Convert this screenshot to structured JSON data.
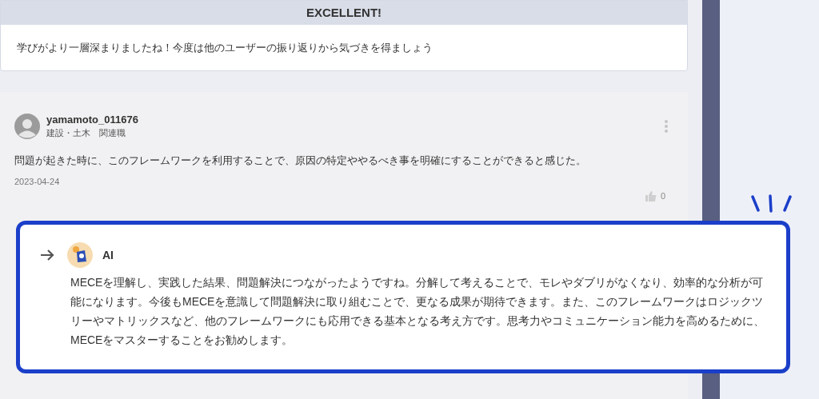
{
  "result": {
    "title": "EXCELLENT!",
    "message": "学びがより一層深まりましたね！今度は他のユーザーの振り返りから気づきを得ましょう"
  },
  "comment": {
    "username": "yamamoto_011676",
    "category": "建設・土木　関連職",
    "body": "問題が起きた時に、このフレームワークを利用することで、原因の特定ややるべき事を明確にすることができると感じた。",
    "date": "2023-04-24",
    "likes": "0",
    "liked": false
  },
  "ai_reply": {
    "name": "AI",
    "body": "MECEを理解し、実践した結果、問題解決につながったようですね。分解して考えることで、モレやダブリがなくなり、効率的な分析が可能になります。今後もMECEを意識して問題解決に取り組むことで、更なる成果が期待できます。また、このフレームワークはロジックツリーやマトリックスなど、他のフレームワークにも応用できる基本となる考え方です。思考力やコミュニケーション能力を高めるために、MECEをマスターすることをお勧めします。",
    "highlighted": true
  }
}
